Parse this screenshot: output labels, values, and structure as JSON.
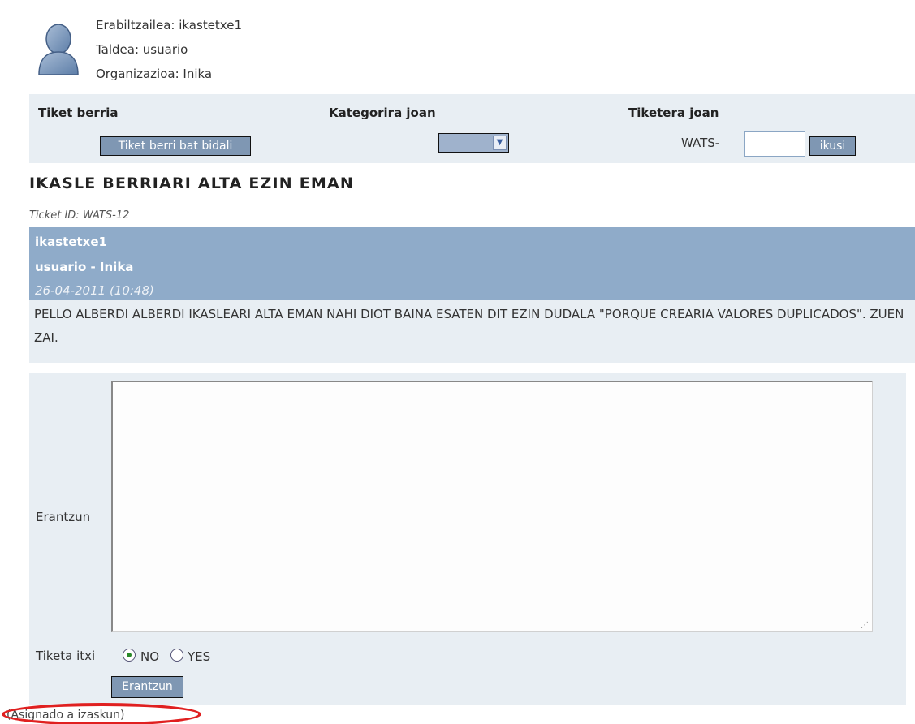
{
  "user": {
    "username_line": "Erabiltzailea: ikastetxe1",
    "group_line": "Taldea: usuario",
    "organization_line": "Organizazioa: Inika"
  },
  "nav": {
    "new_ticket_heading": "Tiket berria",
    "new_ticket_button": "Tiket berri bat bidali",
    "category_heading": "Kategorira joan",
    "category_selected": "",
    "goto_heading": "Tiketera joan",
    "ticket_prefix": "WATS-",
    "ticket_input_value": "",
    "view_button": "ikusi"
  },
  "ticket": {
    "title": "IKASLE BERRIARI ALTA EZIN EMAN",
    "id_line": "Ticket ID: WATS-12"
  },
  "message": {
    "author": "ikastetxe1",
    "group_org": "usuario - Inika",
    "date": "26-04-2011 (10:48)",
    "body": "PELLO ALBERDI ALBERDI IKASLEARI ALTA EMAN NAHI DIOT BAINA ESATEN DIT EZIN DUDALA \"PORQUE CREARIA VALORES DUPLICADOS\". ZUEN ZAI."
  },
  "reply": {
    "label": "Erantzun",
    "textarea_value": "",
    "close_label": "Tiketa itxi",
    "option_no": "NO",
    "option_yes": "YES",
    "selected_option": "NO",
    "submit_button": "Erantzun"
  },
  "footer": {
    "assigned_text": "(Asignado a izaskun)"
  },
  "colors": {
    "nav_bg": "#e8eef3",
    "message_header_bg": "#8fabc9",
    "button_bg": "#7f97b3",
    "annotation": "#e02020"
  }
}
